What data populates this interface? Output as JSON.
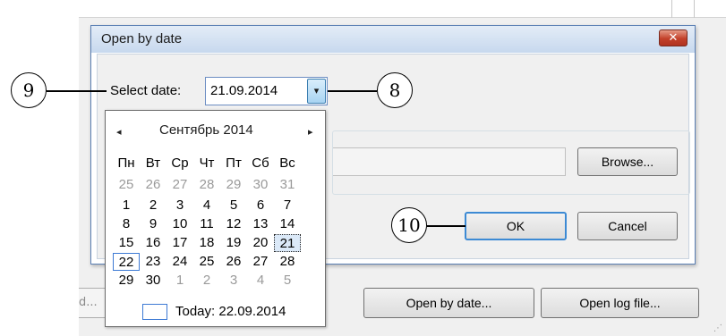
{
  "dialog": {
    "title": "Open by date",
    "close_glyph": "✕",
    "select_date_label": "Select date:",
    "date_value": "21.09.2014",
    "dropdown_glyph": "▾",
    "browse_label": "Browse...",
    "ok_label": "OK",
    "cancel_label": "Cancel"
  },
  "calendar": {
    "month_title": "Сентябрь 2014",
    "prev_glyph": "◂",
    "next_glyph": "▸",
    "weekdays": [
      "Пн",
      "Вт",
      "Ср",
      "Чт",
      "Пт",
      "Сб",
      "Вс"
    ],
    "weeks": [
      [
        "25",
        "26",
        "27",
        "28",
        "29",
        "30",
        "31"
      ],
      [
        "1",
        "2",
        "3",
        "4",
        "5",
        "6",
        "7"
      ],
      [
        "8",
        "9",
        "10",
        "11",
        "12",
        "13",
        "14"
      ],
      [
        "15",
        "16",
        "17",
        "18",
        "19",
        "20",
        "21"
      ],
      [
        "22",
        "23",
        "24",
        "25",
        "26",
        "27",
        "28"
      ],
      [
        "29",
        "30",
        "1",
        "2",
        "3",
        "4",
        "5"
      ]
    ],
    "today_label": "Today: 22.09.2014"
  },
  "parent_window": {
    "stub_text": "d...",
    "open_by_date_label": "Open by date...",
    "open_log_file_label": "Open log file..."
  },
  "callouts": {
    "c8": "8",
    "c9": "9",
    "c10": "10"
  }
}
